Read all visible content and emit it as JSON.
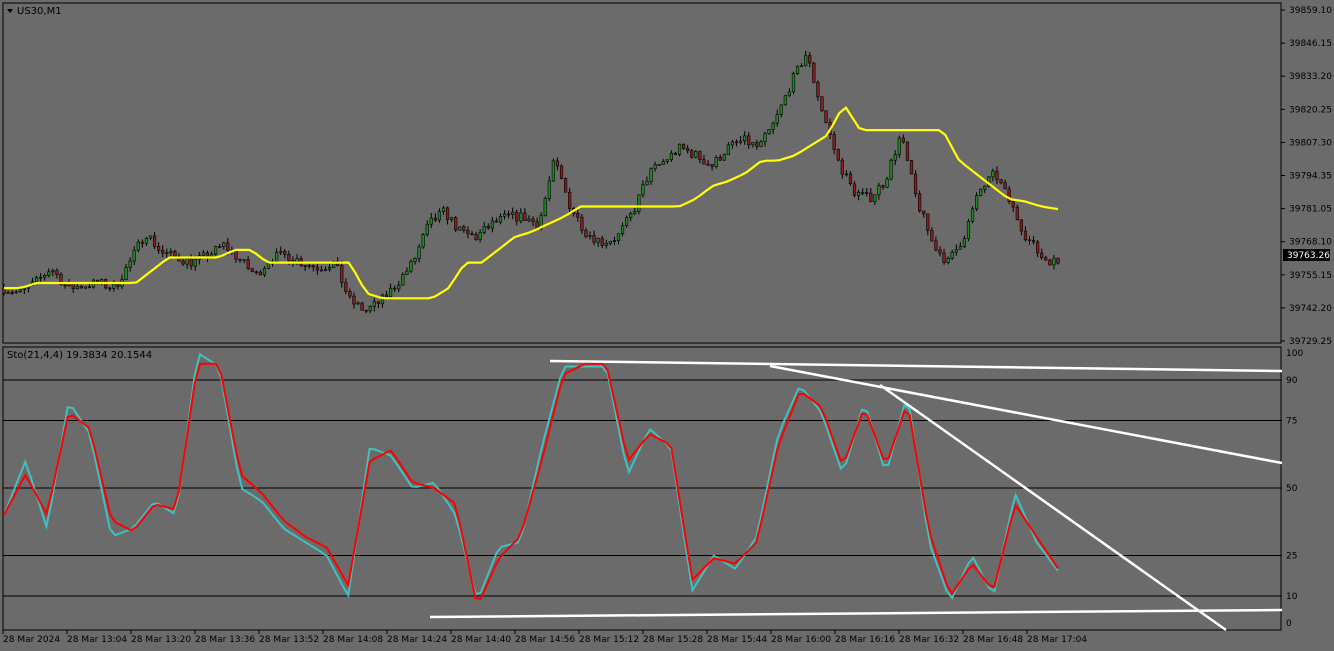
{
  "window": {
    "symbol_label": "US30,M1",
    "indicator_label": "Sto(21,4,4) 19.3834 20.1544",
    "current_price": "39763.26"
  },
  "colors": {
    "background": "#6b6b6b",
    "grid": "#000000",
    "moving_average": "#ffff00",
    "stoch_main": "#40c0c0",
    "stoch_signal": "#ff0000",
    "trendline": "#ffffff",
    "candle": "#000000",
    "bull_candle_body": "#1f8a1f",
    "bear_candle_body": "#8a1f1f"
  },
  "price_axis": {
    "ticks": [
      "39859.10",
      "39846.15",
      "39833.20",
      "39820.25",
      "39807.30",
      "39794.35",
      "39781.05",
      "39768.10",
      "39755.15",
      "39742.20",
      "39729.25"
    ],
    "min": 39729.25,
    "max": 39859.1
  },
  "stoch_axis": {
    "ticks": [
      "100",
      "90",
      "75",
      "50",
      "25",
      "10",
      "0"
    ],
    "levels": [
      90,
      75,
      50,
      25,
      10
    ]
  },
  "time_axis": {
    "labels": [
      "28 Mar 2024",
      "28 Mar 13:04",
      "28 Mar 13:20",
      "28 Mar 13:36",
      "28 Mar 13:52",
      "28 Mar 14:08",
      "28 Mar 14:24",
      "28 Mar 14:40",
      "28 Mar 14:56",
      "28 Mar 15:12",
      "28 Mar 15:28",
      "28 Mar 15:44",
      "28 Mar 16:00",
      "28 Mar 16:16",
      "28 Mar 16:32",
      "28 Mar 16:48",
      "28 Mar 17:04"
    ]
  },
  "chart_data": [
    {
      "type": "candlestick",
      "name": "US30,M1",
      "x_labels": [
        "28 Mar 2024",
        "28 Mar 13:04",
        "28 Mar 13:20",
        "28 Mar 13:36",
        "28 Mar 13:52",
        "28 Mar 14:08",
        "28 Mar 14:24",
        "28 Mar 14:40",
        "28 Mar 14:56",
        "28 Mar 15:12",
        "28 Mar 15:28",
        "28 Mar 15:44",
        "28 Mar 16:00",
        "28 Mar 16:16",
        "28 Mar 16:32",
        "28 Mar 16:48",
        "28 Mar 17:04"
      ],
      "ylim": [
        39729.25,
        39859.1
      ],
      "close_path": [
        39750,
        39748,
        39752,
        39758,
        39750,
        39751,
        39752,
        39750,
        39760,
        39772,
        39764,
        39762,
        39760,
        39763,
        39767,
        39761,
        39755,
        39762,
        39763,
        39760,
        39758,
        39760,
        39745,
        39741,
        39745,
        39752,
        39760,
        39775,
        39780,
        39772,
        39770,
        39775,
        39778,
        39778,
        39775,
        39800,
        39782,
        39772,
        39768,
        39770,
        39780,
        39795,
        39800,
        39805,
        39802,
        39798,
        39805,
        39808,
        39805,
        39815,
        39830,
        39842,
        39820,
        39800,
        39788,
        39785,
        39792,
        39810,
        39785,
        39768,
        39760,
        39770,
        39788,
        39795,
        39783,
        39770,
        39762,
        39760
      ],
      "moving_average_path": [
        39750,
        39750,
        39752,
        39752,
        39752,
        39752,
        39752,
        39752,
        39752,
        39757,
        39762,
        39762,
        39762,
        39762,
        39765,
        39765,
        39760,
        39760,
        39760,
        39760,
        39760,
        39760,
        39748,
        39746,
        39746,
        39746,
        39746,
        39750,
        39760,
        39760,
        39765,
        39770,
        39772,
        39775,
        39778,
        39782,
        39782,
        39782,
        39782,
        39782,
        39782,
        39782,
        39785,
        39790,
        39792,
        39795,
        39800,
        39800,
        39802,
        39806,
        39810,
        39822,
        39812,
        39812,
        39812,
        39812,
        39812,
        39812,
        39800,
        39795,
        39790,
        39785,
        39784,
        39782,
        39781
      ],
      "current_price": 39763.26
    },
    {
      "type": "line",
      "name": "Sto(21,4,4)",
      "ylim": [
        0,
        100
      ],
      "levels": [
        90,
        75,
        50,
        25,
        10
      ],
      "series": [
        {
          "name": "main",
          "values": [
            40,
            60,
            35,
            82,
            70,
            32,
            35,
            45,
            40,
            100,
            95,
            50,
            45,
            35,
            30,
            25,
            10,
            65,
            62,
            50,
            52,
            40,
            8,
            28,
            30,
            65,
            95,
            95,
            95,
            55,
            72,
            65,
            12,
            25,
            20,
            32,
            70,
            88,
            78,
            55,
            82,
            55,
            85,
            30,
            8,
            25,
            10,
            48,
            30,
            19.3834
          ]
        },
        {
          "name": "signal",
          "values": [
            40,
            55,
            40,
            78,
            72,
            38,
            34,
            44,
            42,
            96,
            96,
            55,
            48,
            38,
            32,
            28,
            14,
            60,
            64,
            52,
            50,
            44,
            6,
            24,
            32,
            60,
            92,
            96,
            96,
            60,
            70,
            66,
            16,
            24,
            22,
            30,
            66,
            86,
            80,
            58,
            80,
            58,
            82,
            34,
            10,
            22,
            12,
            44,
            32,
            20.1544
          ]
        }
      ]
    }
  ]
}
